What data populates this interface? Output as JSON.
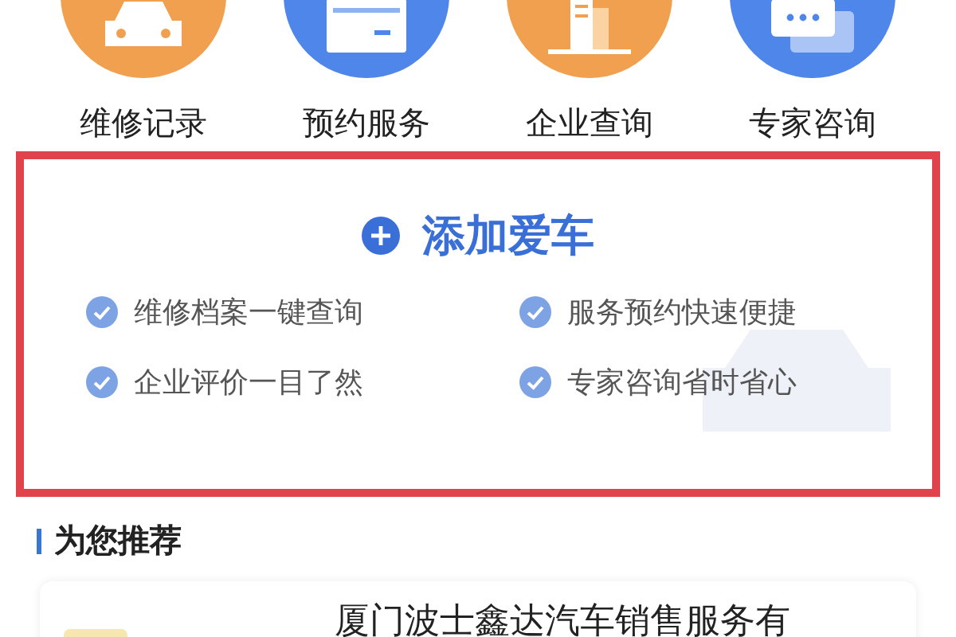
{
  "shortcuts": [
    {
      "label": "维修记录",
      "kind": "car",
      "color": "#f0a04e"
    },
    {
      "label": "预约服务",
      "kind": "calendar",
      "color": "#4f86ea"
    },
    {
      "label": "企业查询",
      "kind": "building",
      "color": "#f0a04e"
    },
    {
      "label": "专家咨询",
      "kind": "chat",
      "color": "#4f86ea"
    }
  ],
  "add_car": {
    "title": "添加爱车",
    "features": [
      "维修档案一键查询",
      "服务预约快速便捷",
      "企业评价一目了然",
      "专家咨询省时省心"
    ]
  },
  "recommend": {
    "heading": "为您推荐",
    "items": [
      {
        "title": "厦门波士鑫达汽车销售服务有"
      }
    ]
  }
}
